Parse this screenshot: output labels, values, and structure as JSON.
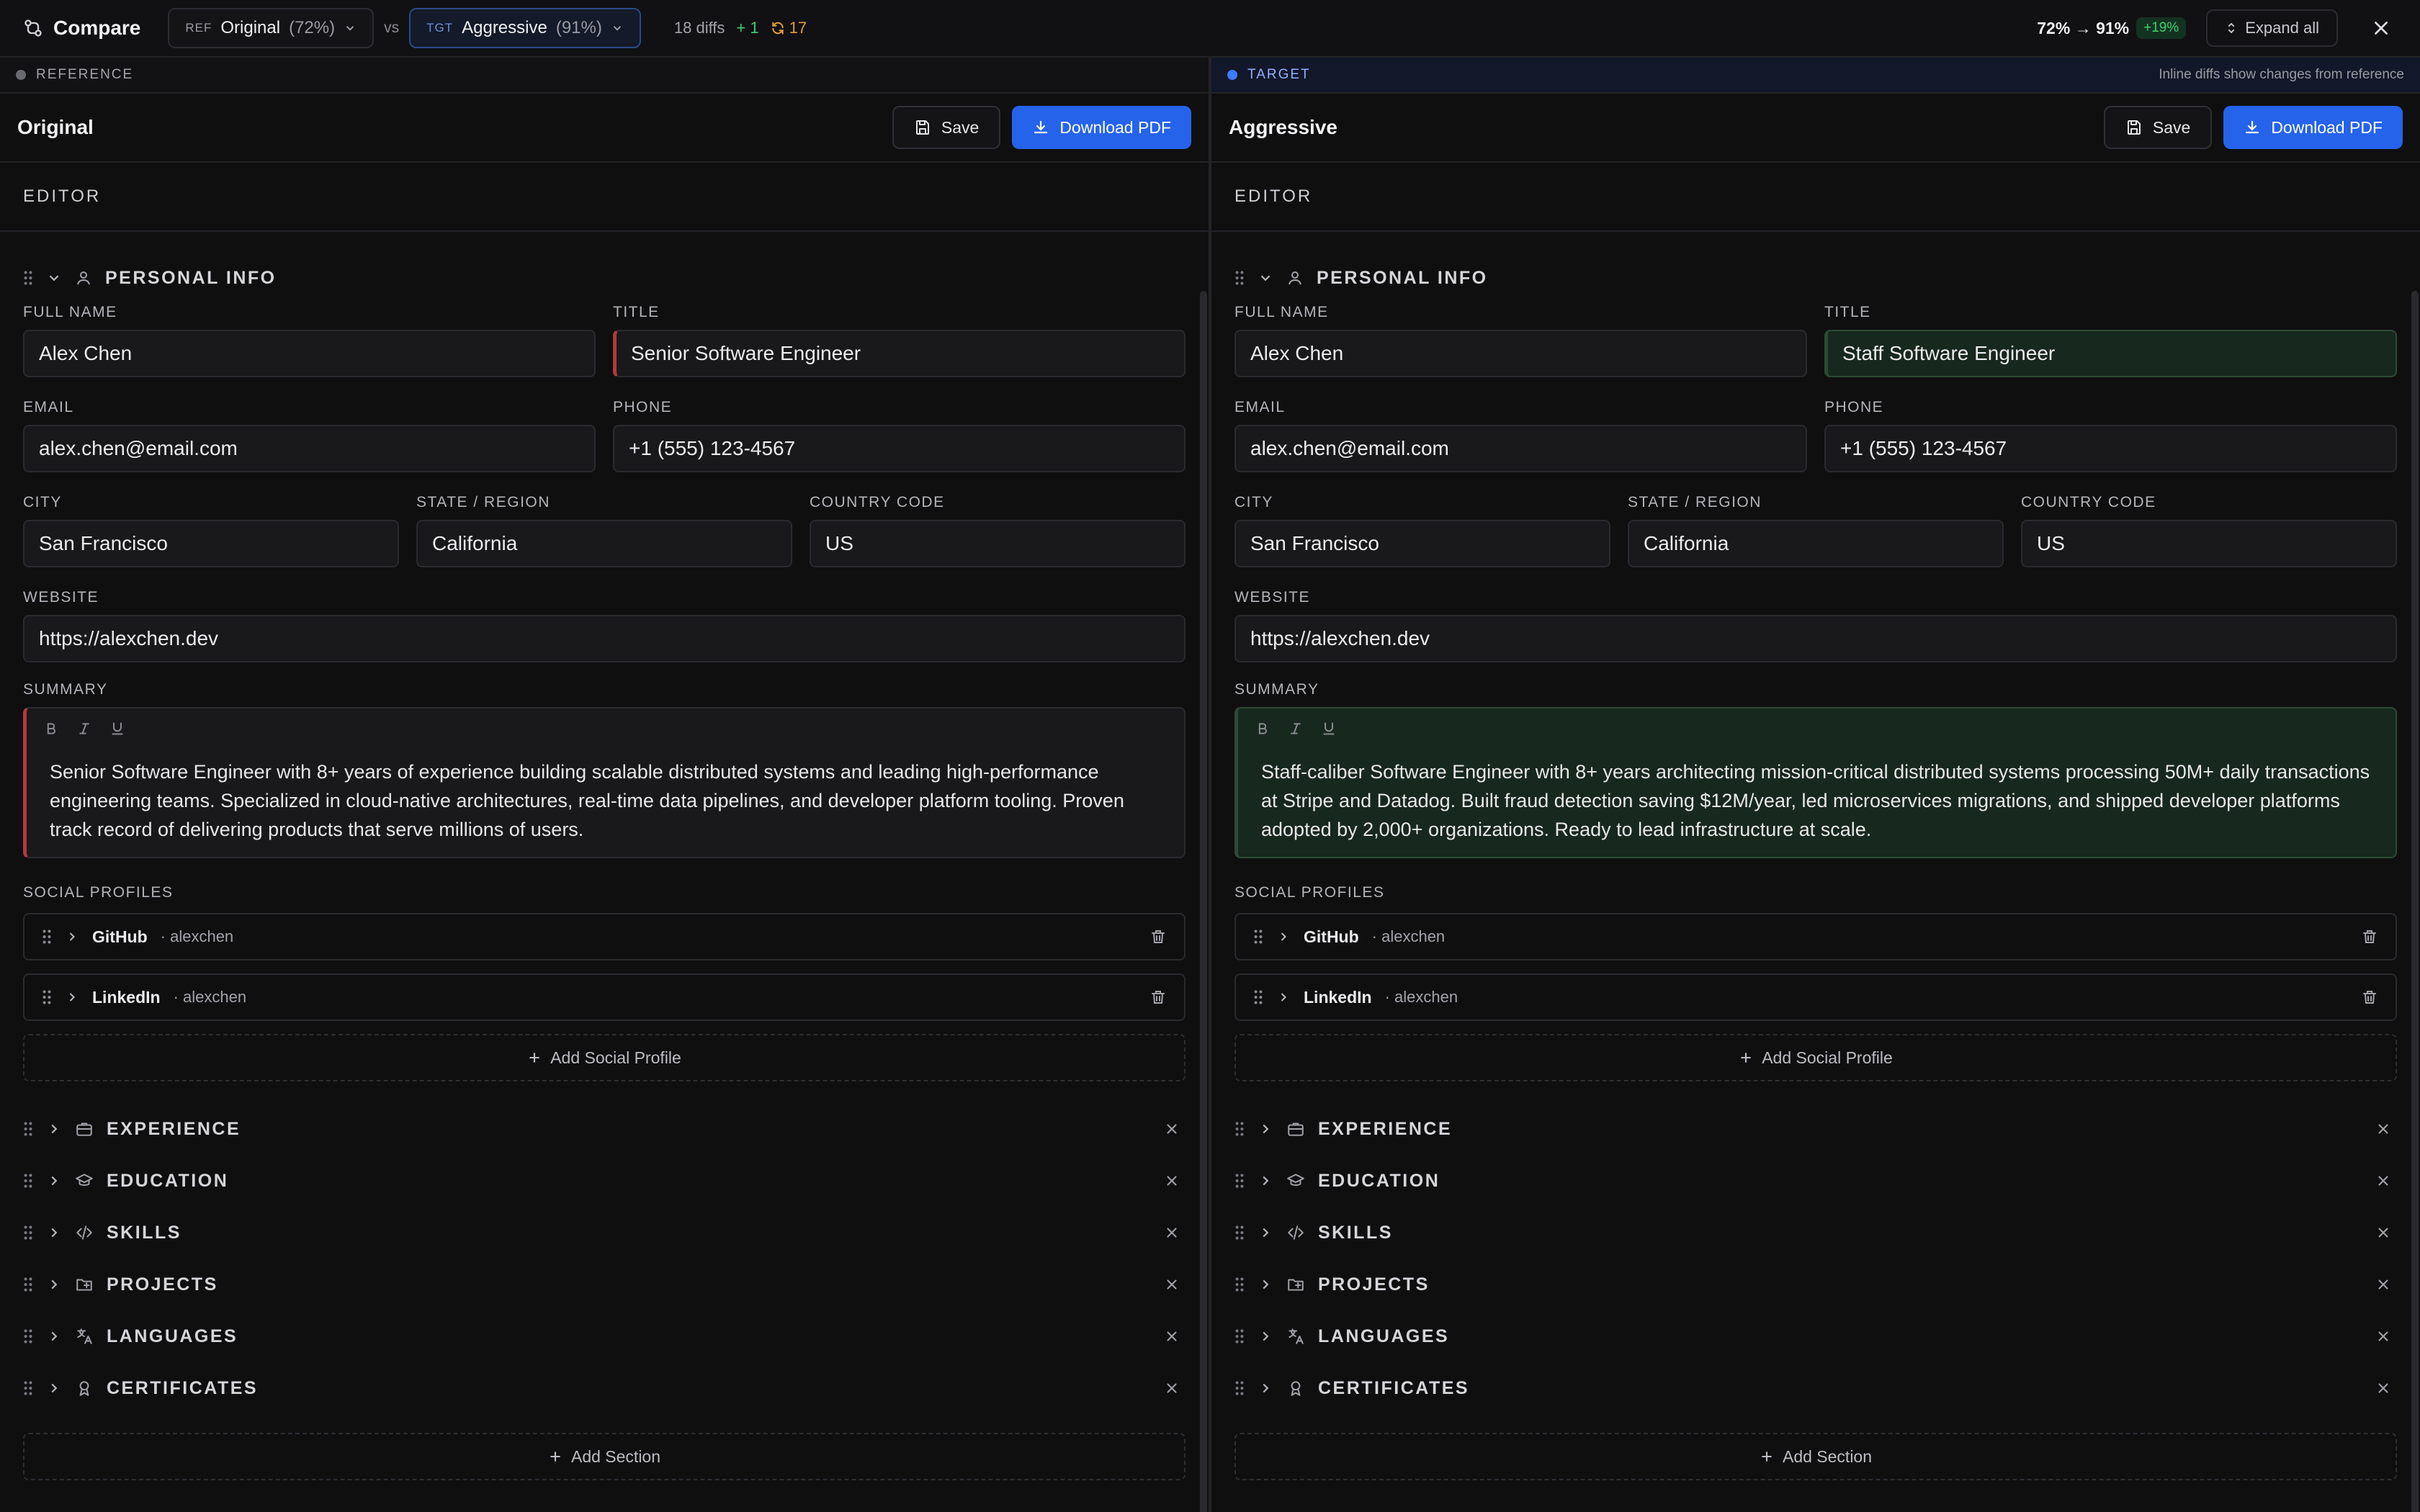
{
  "app": {
    "title": "Compare"
  },
  "compare": {
    "ref": {
      "tag": "REF",
      "name": "Original",
      "pct": "(72%)"
    },
    "vs": "vs",
    "tgt": {
      "tag": "TGT",
      "name": "Aggressive",
      "pct": "(91%)"
    },
    "diffs": "18 diffs",
    "added": "+ 1",
    "changed": "17",
    "score": "72% → 91%",
    "gain": "+19%",
    "expand_all": "Expand all"
  },
  "panes": [
    {
      "strip": "REFERENCE",
      "note": "",
      "title": "Original",
      "save": "Save",
      "pdf": "Download PDF",
      "editor": "EDITOR",
      "personal": {
        "heading": "PERSONAL INFO",
        "full_name_label": "FULL NAME",
        "full_name": "Alex Chen",
        "title_label": "TITLE",
        "title": "Senior Software Engineer",
        "email_label": "EMAIL",
        "email": "alex.chen@email.com",
        "phone_label": "PHONE",
        "phone": "+1 (555) 123-4567",
        "city_label": "CITY",
        "city": "San Francisco",
        "state_label": "STATE / REGION",
        "state": "California",
        "country_label": "COUNTRY CODE",
        "country": "US",
        "website_label": "WEBSITE",
        "website": "https://alexchen.dev",
        "summary_label": "SUMMARY",
        "summary": "Senior Software Engineer with 8+ years of experience building scalable distributed systems and leading high-performance engineering teams. Specialized in cloud-native architectures, real-time data pipelines, and developer platform tooling. Proven track record of delivering products that serve millions of users.",
        "social_label": "SOCIAL PROFILES",
        "socials": [
          {
            "name": "GitHub",
            "handle": "· alexchen"
          },
          {
            "name": "LinkedIn",
            "handle": "· alexchen"
          }
        ],
        "add_social": "Add Social Profile"
      },
      "sections": [
        "EXPERIENCE",
        "EDUCATION",
        "SKILLS",
        "PROJECTS",
        "LANGUAGES",
        "CERTIFICATES"
      ],
      "add_section": "Add Section"
    },
    {
      "strip": "TARGET",
      "note": "Inline diffs show changes from reference",
      "title": "Aggressive",
      "save": "Save",
      "pdf": "Download PDF",
      "editor": "EDITOR",
      "personal": {
        "heading": "PERSONAL INFO",
        "full_name_label": "FULL NAME",
        "full_name": "Alex Chen",
        "title_label": "TITLE",
        "title": "Staff Software Engineer",
        "email_label": "EMAIL",
        "email": "alex.chen@email.com",
        "phone_label": "PHONE",
        "phone": "+1 (555) 123-4567",
        "city_label": "CITY",
        "city": "San Francisco",
        "state_label": "STATE / REGION",
        "state": "California",
        "country_label": "COUNTRY CODE",
        "country": "US",
        "website_label": "WEBSITE",
        "website": "https://alexchen.dev",
        "summary_label": "SUMMARY",
        "summary": "Staff-caliber Software Engineer with 8+ years architecting mission-critical distributed systems processing 50M+ daily transactions at Stripe and Datadog. Built fraud detection saving $12M/year, led microservices migrations, and shipped developer platforms adopted by 2,000+ organizations. Ready to lead infrastructure at scale.",
        "social_label": "SOCIAL PROFILES",
        "socials": [
          {
            "name": "GitHub",
            "handle": "· alexchen"
          },
          {
            "name": "LinkedIn",
            "handle": "· alexchen"
          }
        ],
        "add_social": "Add Social Profile"
      },
      "sections": [
        "EXPERIENCE",
        "EDUCATION",
        "SKILLS",
        "PROJECTS",
        "LANGUAGES",
        "CERTIFICATES"
      ],
      "add_section": "Add Section"
    }
  ],
  "colors": {
    "accent": "#2563eb",
    "added": "#2fb35c",
    "removed": "#b33a3a",
    "changed": "#e09a3a"
  }
}
